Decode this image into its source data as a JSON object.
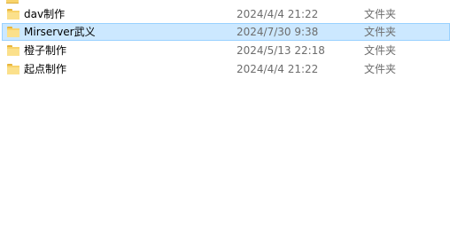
{
  "rows": [
    {
      "name": "dav制作",
      "date": "2024/4/4 21:22",
      "type": "文件夹",
      "selected": false,
      "icon": "folder-icon"
    },
    {
      "name": "Mirserver武义",
      "date": "2024/7/30 9:38",
      "type": "文件夹",
      "selected": true,
      "icon": "folder-icon"
    },
    {
      "name": "橙子制作",
      "date": "2024/5/13 22:18",
      "type": "文件夹",
      "selected": false,
      "icon": "folder-icon"
    },
    {
      "name": "起点制作",
      "date": "2024/4/4 21:22",
      "type": "文件夹",
      "selected": false,
      "icon": "folder-icon"
    }
  ],
  "colors": {
    "selection_bg": "#cce8ff",
    "selection_border": "#99d1ff",
    "folder": "#f8d36b"
  }
}
